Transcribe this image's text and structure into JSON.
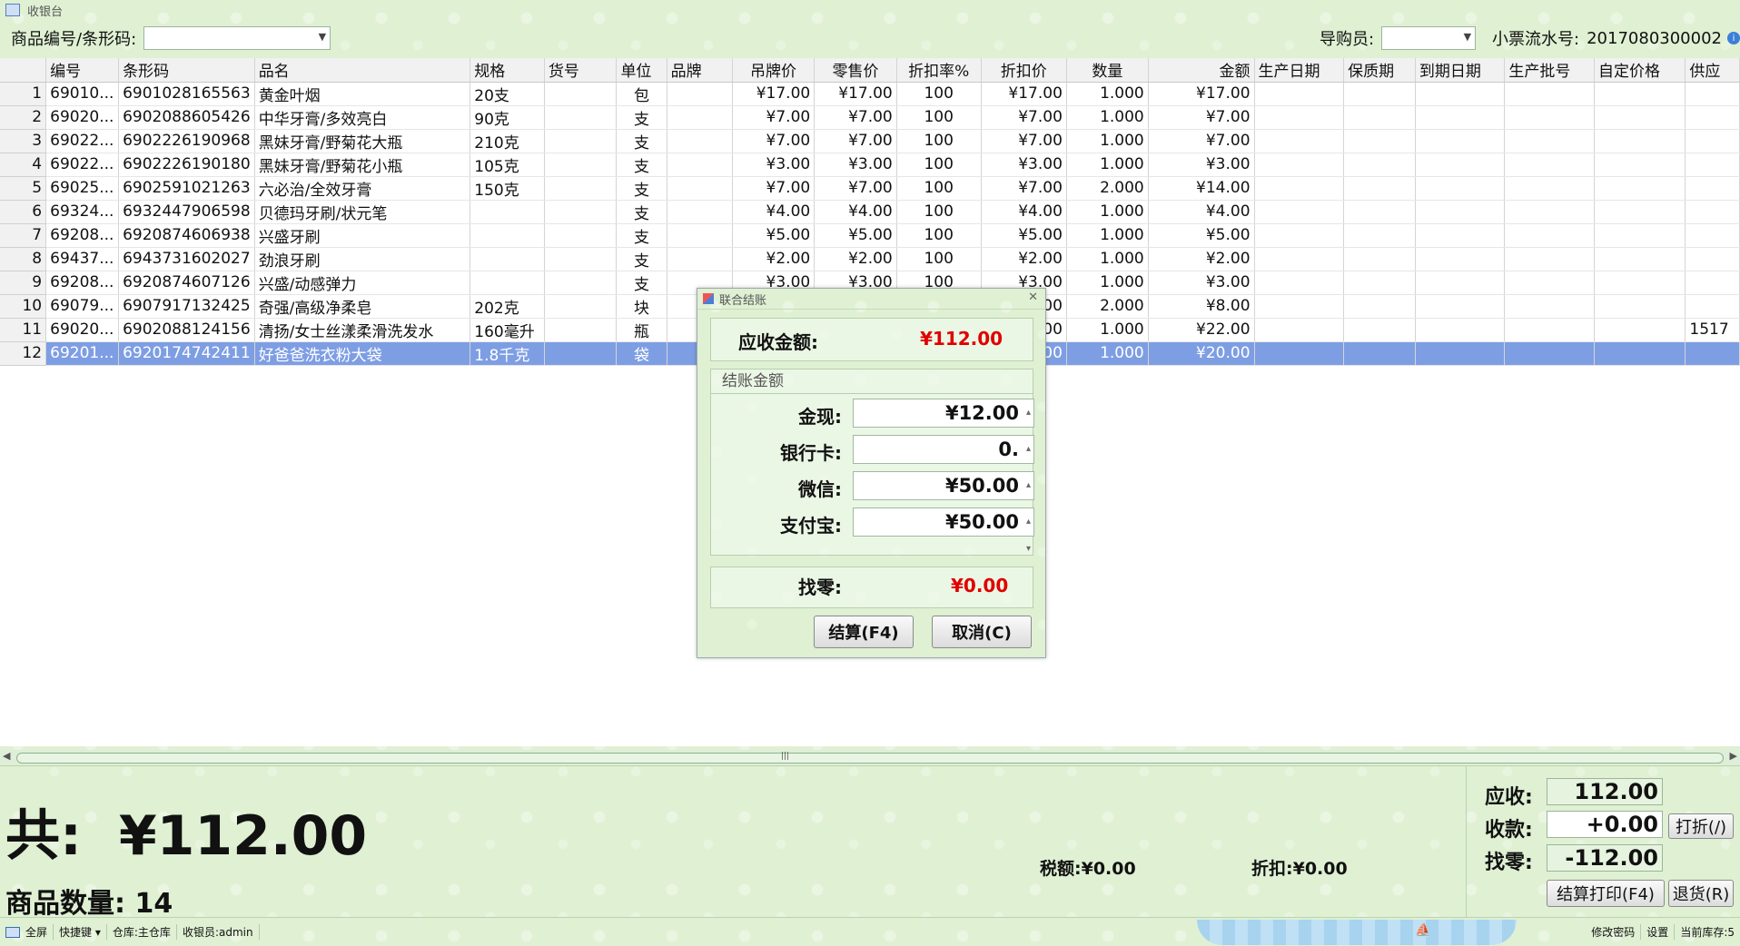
{
  "window": {
    "title": "收银台"
  },
  "toolbar": {
    "product_label": "商品编号/条形码:",
    "product_value": "",
    "guide_label": "导购员:",
    "guide_value": "",
    "ticket_label": "小票流水号:",
    "ticket_value": "2017080300002"
  },
  "grid": {
    "columns": [
      "编号",
      "条形码",
      "品名",
      "规格",
      "货号",
      "单位",
      "品牌",
      "吊牌价",
      "零售价",
      "折扣率%",
      "折扣价",
      "数量",
      "金额",
      "生产日期",
      "保质期",
      "到期日期",
      "生产批号",
      "自定价格",
      "供应"
    ],
    "rows": [
      {
        "no": "1",
        "code": "69010...",
        "barcode": "6901028165563",
        "name": "黄金叶烟",
        "spec": "20支",
        "item": "",
        "unit": "包",
        "brand": "",
        "tag": "¥17.00",
        "retail": "¥17.00",
        "rate": "100",
        "dprice": "¥17.00",
        "qty": "1.000",
        "amount": "¥17.00",
        "supplier": ""
      },
      {
        "no": "2",
        "code": "69020...",
        "barcode": "6902088605426",
        "name": "中华牙膏/多效亮白",
        "spec": "90克",
        "item": "",
        "unit": "支",
        "brand": "",
        "tag": "¥7.00",
        "retail": "¥7.00",
        "rate": "100",
        "dprice": "¥7.00",
        "qty": "1.000",
        "amount": "¥7.00",
        "supplier": ""
      },
      {
        "no": "3",
        "code": "69022...",
        "barcode": "6902226190968",
        "name": "黑妹牙膏/野菊花大瓶",
        "spec": "210克",
        "item": "",
        "unit": "支",
        "brand": "",
        "tag": "¥7.00",
        "retail": "¥7.00",
        "rate": "100",
        "dprice": "¥7.00",
        "qty": "1.000",
        "amount": "¥7.00",
        "supplier": ""
      },
      {
        "no": "4",
        "code": "69022...",
        "barcode": "6902226190180",
        "name": "黑妹牙膏/野菊花小瓶",
        "spec": "105克",
        "item": "",
        "unit": "支",
        "brand": "",
        "tag": "¥3.00",
        "retail": "¥3.00",
        "rate": "100",
        "dprice": "¥3.00",
        "qty": "1.000",
        "amount": "¥3.00",
        "supplier": ""
      },
      {
        "no": "5",
        "code": "69025...",
        "barcode": "6902591021263",
        "name": "六必治/全效牙膏",
        "spec": "150克",
        "item": "",
        "unit": "支",
        "brand": "",
        "tag": "¥7.00",
        "retail": "¥7.00",
        "rate": "100",
        "dprice": "¥7.00",
        "qty": "2.000",
        "amount": "¥14.00",
        "supplier": ""
      },
      {
        "no": "6",
        "code": "69324...",
        "barcode": "6932447906598",
        "name": "贝德玛牙刷/状元笔",
        "spec": "",
        "item": "",
        "unit": "支",
        "brand": "",
        "tag": "¥4.00",
        "retail": "¥4.00",
        "rate": "100",
        "dprice": "¥4.00",
        "qty": "1.000",
        "amount": "¥4.00",
        "supplier": ""
      },
      {
        "no": "7",
        "code": "69208...",
        "barcode": "6920874606938",
        "name": "兴盛牙刷",
        "spec": "",
        "item": "",
        "unit": "支",
        "brand": "",
        "tag": "¥5.00",
        "retail": "¥5.00",
        "rate": "100",
        "dprice": "¥5.00",
        "qty": "1.000",
        "amount": "¥5.00",
        "supplier": ""
      },
      {
        "no": "8",
        "code": "69437...",
        "barcode": "6943731602027",
        "name": "劲浪牙刷",
        "spec": "",
        "item": "",
        "unit": "支",
        "brand": "",
        "tag": "¥2.00",
        "retail": "¥2.00",
        "rate": "100",
        "dprice": "¥2.00",
        "qty": "1.000",
        "amount": "¥2.00",
        "supplier": ""
      },
      {
        "no": "9",
        "code": "69208...",
        "barcode": "6920874607126",
        "name": "兴盛/动感弹力",
        "spec": "",
        "item": "",
        "unit": "支",
        "brand": "",
        "tag": "¥3.00",
        "retail": "¥3.00",
        "rate": "100",
        "dprice": "¥3.00",
        "qty": "1.000",
        "amount": "¥3.00",
        "supplier": ""
      },
      {
        "no": "10",
        "code": "69079...",
        "barcode": "6907917132425",
        "name": "奇强/高级净柔皂",
        "spec": "202克",
        "item": "",
        "unit": "块",
        "brand": "",
        "tag": "",
        "retail": "",
        "rate": "",
        "dprice": "¥4.00",
        "qty": "2.000",
        "amount": "¥8.00",
        "supplier": ""
      },
      {
        "no": "11",
        "code": "69020...",
        "barcode": "6902088124156",
        "name": "清扬/女士丝漾柔滑洗发水",
        "spec": "160毫升",
        "item": "",
        "unit": "瓶",
        "brand": "",
        "tag": "",
        "retail": "",
        "rate": "",
        "dprice": "¥22.00",
        "qty": "1.000",
        "amount": "¥22.00",
        "supplier": "1517"
      },
      {
        "no": "12",
        "code": "69201...",
        "barcode": "6920174742411",
        "name": "好爸爸洗衣粉大袋",
        "spec": "1.8千克",
        "item": "",
        "unit": "袋",
        "brand": "",
        "tag": "",
        "retail": "",
        "rate": "",
        "dprice": "¥20.00",
        "qty": "1.000",
        "amount": "¥20.00",
        "supplier": ""
      }
    ]
  },
  "summary": {
    "total_label": "共:",
    "total_value": "¥112.00",
    "count_label": "商品数量:",
    "count_value": "14",
    "tax_label": "税额:",
    "tax_value": "¥0.00",
    "discount_label": "折扣:",
    "discount_value": "¥0.00"
  },
  "settle": {
    "due_label": "应收:",
    "due_value": "112.00",
    "received_label": "收款:",
    "received_value": "+0.00",
    "change_label": "找零:",
    "change_value": "-112.00",
    "discount_button": "打折(/)",
    "print_button": "结算打印(F4)",
    "return_button": "退货(R)"
  },
  "status": {
    "fullscreen": "全屏",
    "shortcuts": "快捷键",
    "warehouse": "仓库:主仓库",
    "cashier": "收银员:admin",
    "change_password": "修改密码",
    "settings": "设置",
    "stock": "当前库存:5"
  },
  "dialog": {
    "title": "联合结账",
    "due_label": "应收金额:",
    "due_value": "¥112.00",
    "group_label": "结账金额",
    "cash_label": "金现:",
    "cash_value": "¥12.00",
    "card_label": "银行卡:",
    "card_value": "0.",
    "wechat_label": "微信:",
    "wechat_value": "¥50.00",
    "alipay_label": "支付宝:",
    "alipay_value": "¥50.00",
    "change_label": "找零:",
    "change_value": "¥0.00",
    "settle_button": "结算(F4)",
    "cancel_button": "取消(C)"
  },
  "colors": {
    "background": "#dff0d3",
    "selected_row": "#7e9ee4",
    "amount_red": "#e00000"
  }
}
